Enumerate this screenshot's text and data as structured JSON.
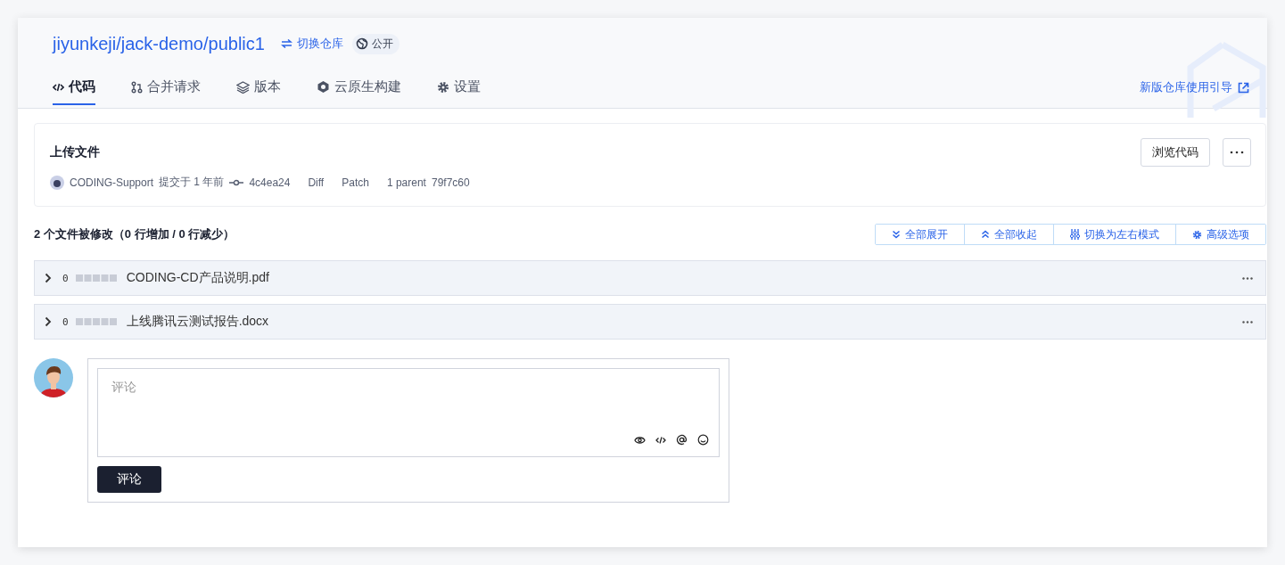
{
  "repo": {
    "path": "jiyunkeji/jack-demo/public1",
    "switch_label": "切换仓库",
    "visibility": "公开"
  },
  "tabs": [
    {
      "label": "代码",
      "kind": "code",
      "selected": true
    },
    {
      "label": "合并请求",
      "kind": "merge",
      "selected": false
    },
    {
      "label": "版本",
      "kind": "layers",
      "selected": false
    },
    {
      "label": "云原生构建",
      "kind": "build",
      "selected": false
    },
    {
      "label": "设置",
      "kind": "gear",
      "selected": false
    }
  ],
  "guide_link": "新版仓库使用引导",
  "commit": {
    "title": "上传文件",
    "author": "CODING-Support",
    "time": "提交于 1 年前",
    "hash": "4c4ea24",
    "diff": "Diff",
    "patch": "Patch",
    "parent_label": "1 parent",
    "parent_hash": "79f7c60",
    "browse_button": "浏览代码"
  },
  "summary": "2 个文件被修改（0 行增加 / 0 行减少）",
  "actions": [
    {
      "label": "全部展开",
      "kind": "expand"
    },
    {
      "label": "全部收起",
      "kind": "collapse"
    },
    {
      "label": "切换为左右模式",
      "kind": "split"
    },
    {
      "label": "高级选项",
      "kind": "gear"
    }
  ],
  "files": [
    {
      "changes": "0",
      "name": "CODING-CD产品说明.pdf",
      "expanded": false
    },
    {
      "changes": "0",
      "name": "上线腾讯云测试报告.docx",
      "expanded": false
    }
  ],
  "comment": {
    "placeholder": "评论",
    "submit": "评论"
  }
}
